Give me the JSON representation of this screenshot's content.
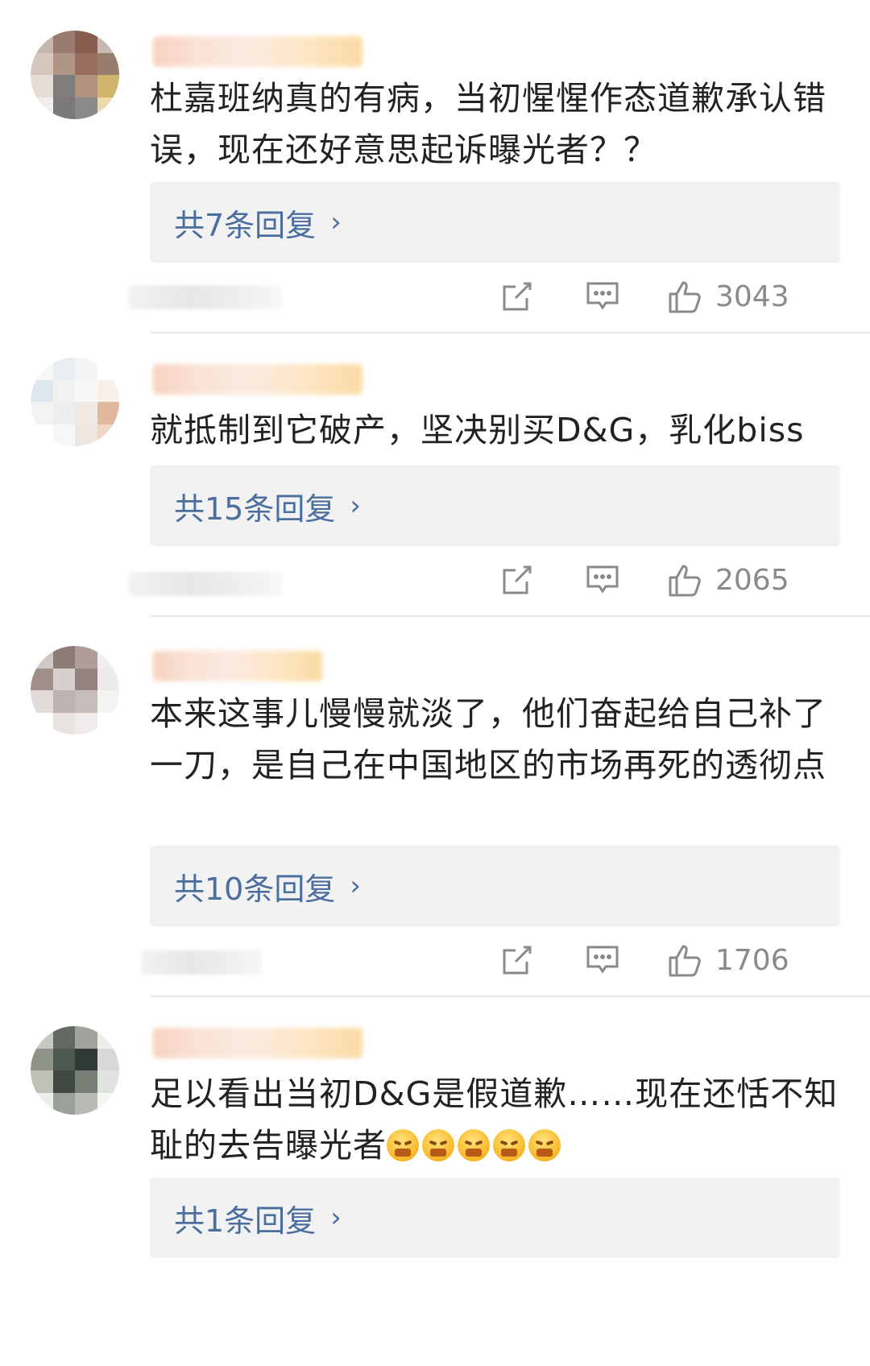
{
  "comments": [
    {
      "text": "杜嘉班纳真的有病，当初惺惺作态道歉承认错误，现在还好意思起诉曝光者？？",
      "reply_label": "共7条回复",
      "likes": "3043"
    },
    {
      "text": "就抵制到它破产，坚决别买D&G，乳化biss",
      "reply_label": "共15条回复",
      "likes": "2065"
    },
    {
      "text": "本来这事儿慢慢就淡了，他们奋起给自己补了一刀，是自己在中国地区的市场再死的透彻点",
      "reply_label": "共10条回复",
      "likes": "1706"
    },
    {
      "text": "足以看出当初D&G是假道歉……现在还恬不知耻的去告曝光者",
      "reply_label": "共1条回复",
      "emoji_count": 5
    }
  ],
  "icons": {
    "share": "share-icon",
    "comment": "comment-icon",
    "like": "thumbs-up-icon",
    "reply_chevron": "chevron-right-icon",
    "emoji": "angry-emoji-icon"
  },
  "colors": {
    "link": "#4a6e9e",
    "text": "#222222",
    "reply_bg": "#f2f2f2",
    "icon": "#8a8a8a"
  }
}
